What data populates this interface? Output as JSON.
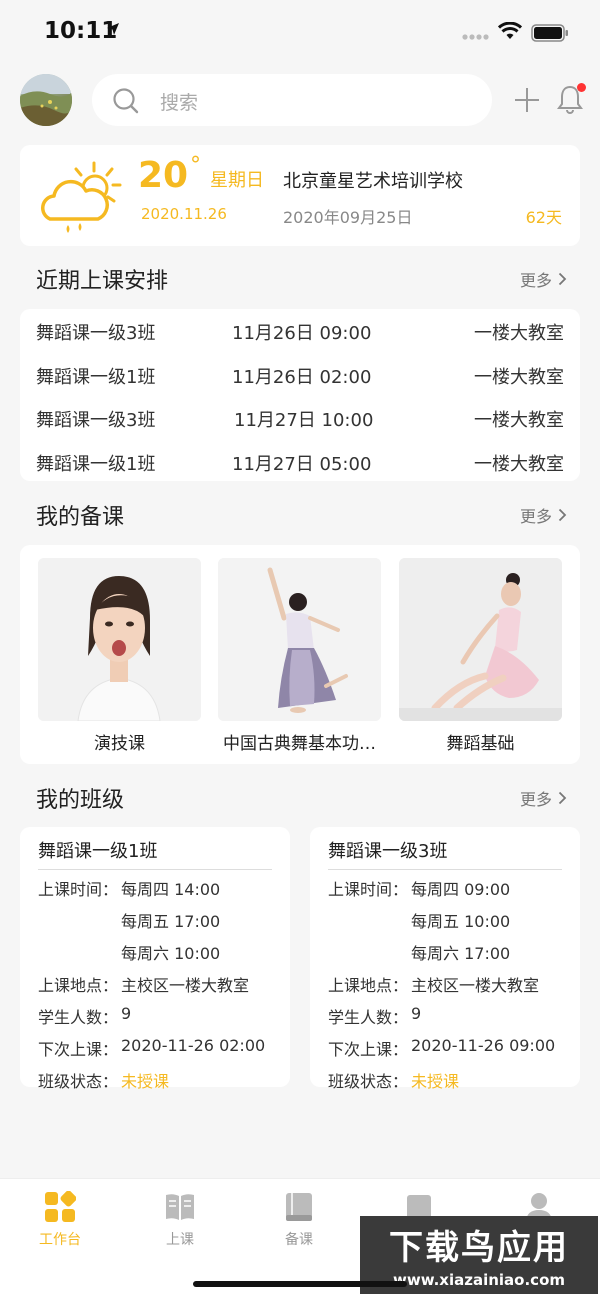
{
  "status_bar": {
    "time": "10:11"
  },
  "search": {
    "placeholder": "搜索"
  },
  "weather": {
    "temperature": "20",
    "degree": "°",
    "weekday": "星期日",
    "date": "2020.11.26",
    "school": "北京童星艺术培训学校",
    "school_date": "2020年09月25日",
    "days": "62天"
  },
  "schedule_section": {
    "title": "近期上课安排",
    "more": "更多"
  },
  "schedule": [
    {
      "class": "舞蹈课一级3班",
      "time": "11月26日 09:00",
      "room": "一楼大教室"
    },
    {
      "class": "舞蹈课一级1班",
      "time": "11月26日 02:00",
      "room": "一楼大教室"
    },
    {
      "class": "舞蹈课一级3班",
      "time": "11月27日 10:00",
      "room": "一楼大教室"
    },
    {
      "class": "舞蹈课一级1班",
      "time": "11月27日 05:00",
      "room": "一楼大教室"
    }
  ],
  "prep_section": {
    "title": "我的备课",
    "more": "更多"
  },
  "prep_items": [
    {
      "caption": "演技课"
    },
    {
      "caption": "中国古典舞基本功…"
    },
    {
      "caption": "舞蹈基础"
    }
  ],
  "class_section": {
    "title": "我的班级",
    "more": "更多"
  },
  "classes": [
    {
      "name": "舞蹈课一级1班",
      "time_label": "上课时间：",
      "times": [
        "每周四 14:00",
        "每周五 17:00",
        "每周六 10:00"
      ],
      "place_label": "上课地点：",
      "place": "主校区一楼大教室",
      "count_label": "学生人数：",
      "count": "9",
      "next_label": "下次上课：",
      "next": "2020-11-26 02:00",
      "state_label": "班级状态：",
      "state": "未授课"
    },
    {
      "name": "舞蹈课一级3班",
      "time_label": "上课时间：",
      "times": [
        "每周四 09:00",
        "每周五 10:00",
        "每周六 17:00"
      ],
      "place_label": "上课地点：",
      "place": "主校区一楼大教室",
      "count_label": "学生人数：",
      "count": "9",
      "next_label": "下次上课：",
      "next": "2020-11-26 09:00",
      "state_label": "班级状态：",
      "state": "未授课"
    }
  ],
  "tabs": [
    {
      "label": "工作台",
      "icon": "dashboard-icon"
    },
    {
      "label": "上课",
      "icon": "book-open-icon"
    },
    {
      "label": "备课",
      "icon": "notebook-icon"
    }
  ],
  "watermark": {
    "title": "下载鸟应用",
    "url": "www.xiazainiao.com"
  },
  "colors": {
    "accent": "#f5b921",
    "background": "#f6f6f6",
    "badge": "#ff3333"
  }
}
